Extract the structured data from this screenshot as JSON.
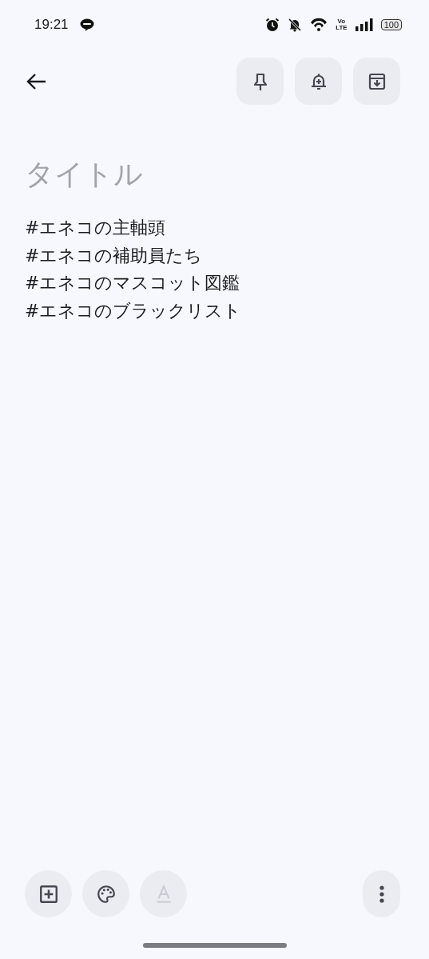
{
  "status_bar": {
    "time": "19:21",
    "network_label": [
      "Vo",
      "LTE"
    ],
    "battery": "100"
  },
  "toolbar": {
    "buttons": [
      {
        "kind": "pin"
      },
      {
        "kind": "reminder"
      },
      {
        "kind": "archive"
      }
    ]
  },
  "note": {
    "title_placeholder": "タイトル",
    "body_lines": [
      "#エネコの主軸頭",
      "#エネコの補助員たち",
      "#エネコのマスコット図鑑",
      "#エネコのブラックリスト"
    ]
  },
  "bottom_bar": {
    "buttons": [
      {
        "kind": "add",
        "disabled": false
      },
      {
        "kind": "palette",
        "disabled": false
      },
      {
        "kind": "text-format",
        "disabled": true
      }
    ]
  }
}
